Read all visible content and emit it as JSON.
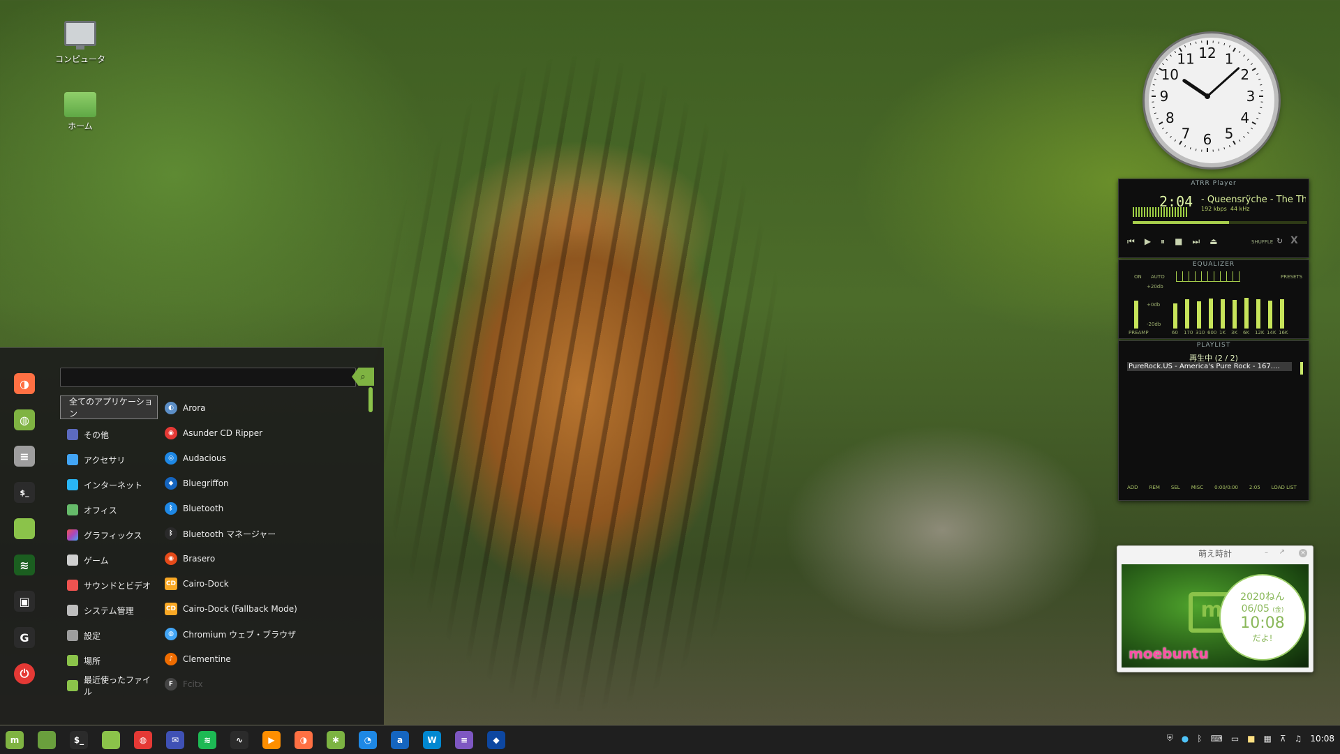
{
  "desktop": {
    "icons": [
      {
        "label": "コンピュータ",
        "icon": "computer-icon"
      },
      {
        "label": "ホーム",
        "icon": "home-folder-icon"
      }
    ]
  },
  "menu": {
    "search_placeholder": "",
    "sidebar": [
      "firefox-icon",
      "software-manager-icon",
      "settings-icon",
      "terminal-icon",
      "files-icon",
      "spotify-icon",
      "lock-icon",
      "logout-icon",
      "power-icon"
    ],
    "categories": [
      {
        "label": "全てのアプリケーション",
        "color": "#444444"
      },
      {
        "label": "その他",
        "color": "#5c6bc0"
      },
      {
        "label": "アクセサリ",
        "color": "#42a5f5"
      },
      {
        "label": "インターネット",
        "color": "#29b6f6"
      },
      {
        "label": "オフィス",
        "color": "#66bb6a"
      },
      {
        "label": "グラフィックス",
        "color": "#ab47bc"
      },
      {
        "label": "ゲーム",
        "color": "#cfcfcf"
      },
      {
        "label": "サウンドとビデオ",
        "color": "#ef5350"
      },
      {
        "label": "システム管理",
        "color": "#bdbdbd"
      },
      {
        "label": "設定",
        "color": "#9e9e9e"
      },
      {
        "label": "場所",
        "color": "#8bc34a"
      },
      {
        "label": "最近使ったファイル",
        "color": "#8bc34a"
      }
    ],
    "apps": [
      {
        "label": "Arora",
        "color": "#5c8fc7",
        "glyph": "◐"
      },
      {
        "label": "Asunder CD Ripper",
        "color": "#e53935",
        "glyph": "◉"
      },
      {
        "label": "Audacious",
        "color": "#1e88e5",
        "glyph": "◎"
      },
      {
        "label": "Bluegriffon",
        "color": "#1565c0",
        "glyph": "◆"
      },
      {
        "label": "Bluetooth",
        "color": "#1e88e5",
        "glyph": "ᛒ"
      },
      {
        "label": "Bluetooth マネージャー",
        "color": "#2a2a2a",
        "glyph": "ᛒ"
      },
      {
        "label": "Brasero",
        "color": "#e64a19",
        "glyph": "◉"
      },
      {
        "label": "Cairo-Dock",
        "color": "#f9a825",
        "glyph": "CD"
      },
      {
        "label": "Cairo-Dock (Fallback Mode)",
        "color": "#f9a825",
        "glyph": "CD"
      },
      {
        "label": "Chromium ウェブ・ブラウザ",
        "color": "#42a5f5",
        "glyph": "◍"
      },
      {
        "label": "Clementine",
        "color": "#ef6c00",
        "glyph": "♪"
      },
      {
        "label": "Fcitx",
        "color": "#555555",
        "glyph": "F"
      }
    ]
  },
  "clock": {
    "hour": 10,
    "minute": 8
  },
  "player": {
    "title": "ATRR Player",
    "time": "2:04",
    "track": "- Queensrÿche - The Thi",
    "bitrate": "192 kbps",
    "samplerate": "44 kHz",
    "shuffle_label": "SHUFFLE",
    "progress": 0.55
  },
  "equalizer": {
    "title": "EQUALIZER",
    "on_label": "ON",
    "auto_label": "AUTO",
    "presets_label": "PRESETS",
    "preamp_label": "PREAMP",
    "db_top": "+20db",
    "db_mid": "+0db",
    "db_bot": "-20db",
    "bands": [
      "60",
      "170",
      "310",
      "600",
      "1K",
      "3K",
      "6K",
      "12K",
      "14K",
      "16K"
    ],
    "levels": [
      0.6,
      0.7,
      0.65,
      0.72,
      0.7,
      0.68,
      0.74,
      0.7,
      0.66,
      0.7
    ]
  },
  "playlist": {
    "title": "PLAYLIST",
    "now_playing": "再生中 (2 / 2)",
    "items": [
      "PureRock.US - America's Pure Rock - 167.…"
    ],
    "buttons": [
      "ADD",
      "REM",
      "SEL",
      "MISC"
    ],
    "time_display": "0:00/0:00",
    "remaining": "2:05",
    "list_label": "LOAD LIST"
  },
  "moe_clock": {
    "title": "萌え時計",
    "brand": "moebuntu",
    "date_line1": "2020ねん",
    "date_line2": "06/05",
    "weekday": "(金)",
    "time": "10:08",
    "suffix": "だよ!"
  },
  "taskbar": {
    "apps": [
      {
        "name": "mint-menu-icon",
        "color": "#7fb342",
        "glyph": "m"
      },
      {
        "name": "show-desktop-icon",
        "color": "#6a9f3d",
        "glyph": ""
      },
      {
        "name": "terminal-icon",
        "color": "#2b2b2b",
        "glyph": "$_"
      },
      {
        "name": "files-icon",
        "color": "#8bc34a",
        "glyph": ""
      },
      {
        "name": "chrome-icon",
        "color": "#e53935",
        "glyph": "◍"
      },
      {
        "name": "mail-icon",
        "color": "#3f51b5",
        "glyph": "✉"
      },
      {
        "name": "spotify-icon",
        "color": "#1db954",
        "glyph": "≋"
      },
      {
        "name": "system-monitor-icon",
        "color": "#2b2b2b",
        "glyph": "∿"
      },
      {
        "name": "media-player-icon",
        "color": "#ff8f00",
        "glyph": "▶"
      },
      {
        "name": "firefox-icon",
        "color": "#ff7043",
        "glyph": "◑"
      },
      {
        "name": "gimp-icon",
        "color": "#7cb342",
        "glyph": "✱"
      },
      {
        "name": "shutter-icon",
        "color": "#1e88e5",
        "glyph": "◔"
      },
      {
        "name": "amarok-icon",
        "color": "#1565c0",
        "glyph": "a"
      },
      {
        "name": "writer-icon",
        "color": "#0288d1",
        "glyph": "W"
      },
      {
        "name": "text-editor-icon",
        "color": "#7e57c2",
        "glyph": "≡"
      },
      {
        "name": "bluegriffon-icon",
        "color": "#0d47a1",
        "glyph": "◆"
      }
    ],
    "tray": [
      "shield-icon",
      "bluetooth-status-icon",
      "bluetooth-icon",
      "keyboard-icon",
      "display-icon",
      "notes-icon",
      "input-method-icon",
      "network-icon",
      "music-icon"
    ],
    "time": "10:08"
  }
}
